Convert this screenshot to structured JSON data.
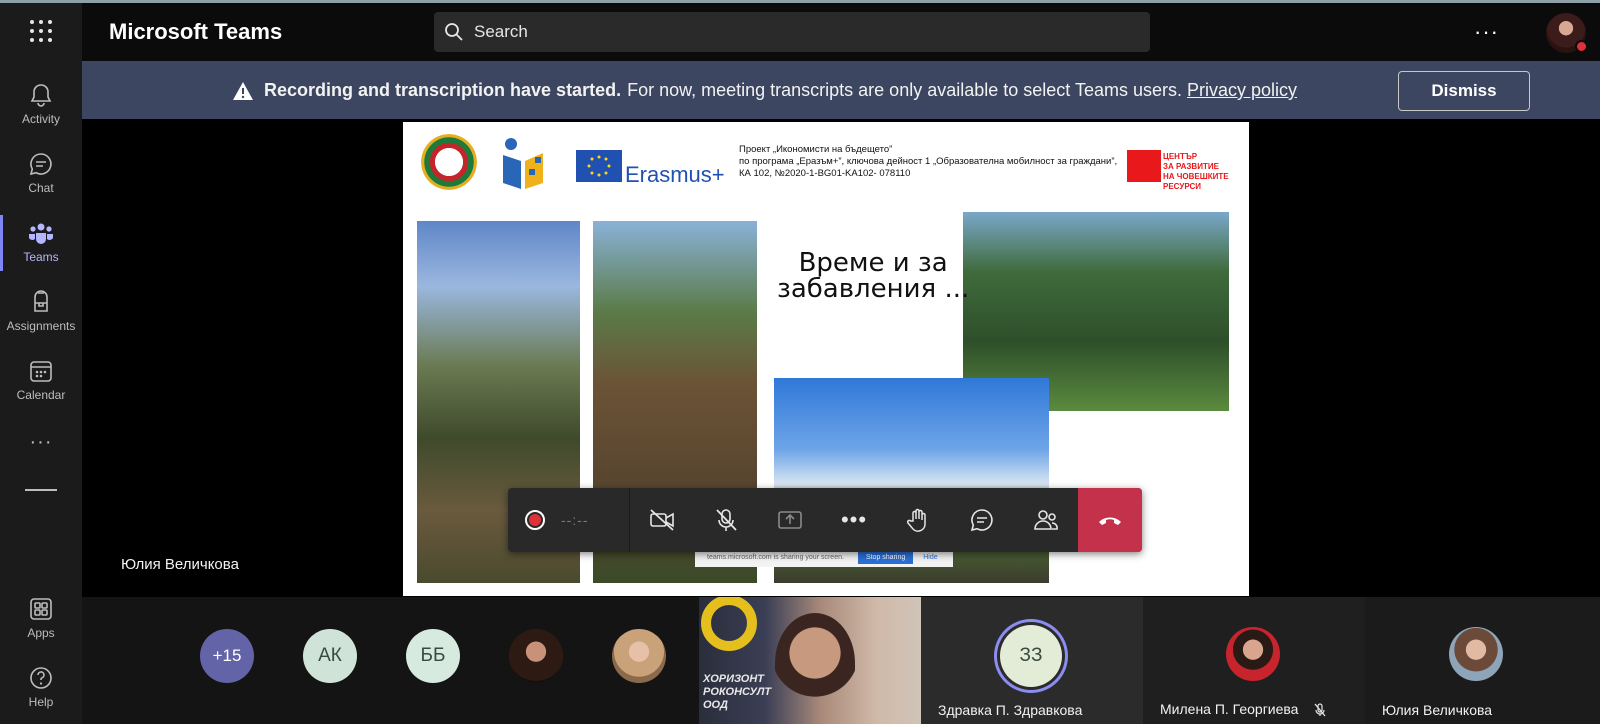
{
  "app": {
    "title": "Microsoft Teams"
  },
  "search": {
    "placeholder": "Search"
  },
  "top": {
    "more": "···"
  },
  "rail": {
    "items": [
      {
        "label": "Activity"
      },
      {
        "label": "Chat"
      },
      {
        "label": "Teams"
      },
      {
        "label": "Assignments"
      },
      {
        "label": "Calendar"
      },
      {
        "label": "Apps"
      },
      {
        "label": "Help"
      }
    ],
    "more": "···"
  },
  "banner": {
    "bold": "Recording and transcription have started.",
    "text": "For now, meeting transcripts are only available to select Teams users.",
    "link": "Privacy policy",
    "dismiss": "Dismiss"
  },
  "slide": {
    "title_line1": "Време и за",
    "title_line2": "забавления ...",
    "eu_text": "Erasmus+",
    "project_line1": "Проект „Икономисти на бъдещето”",
    "project_line2": "по програма „Еразъм+”, ключова дейност 1 „Образователна мобилност за граждани”,",
    "project_line3": "КА 102, №2020-1-BG01-KA102- 078110",
    "hrd_line1": "ЦЕНТЪР",
    "hrd_line2": "ЗА РАЗВИТИЕ",
    "hrd_line3": "НА ЧОВЕШКИТЕ",
    "hrd_line4": "РЕСУРСИ",
    "share_notice": "teams.microsoft.com is sharing your screen.",
    "stop_sharing": "Stop sharing",
    "hide": "Hide"
  },
  "presenter": {
    "name": "Юлия Величкова"
  },
  "controls": {
    "timer": "--:--",
    "more": "•••"
  },
  "participants": {
    "overflow": "+15",
    "ak": "АК",
    "bb": "ББ",
    "tile_brand_line1": "ХОРИЗОНТ",
    "tile_brand_line2": "РОКОНСУЛТ",
    "tile_brand_line3": "ООД",
    "initials_33": "ЗЗ",
    "name_33": "Здравка П. Здравкова",
    "name_ph3": "Милена П. Георгиева",
    "name_ph4": "Юлия Величкова"
  },
  "colors": {
    "accent": "#6264a7",
    "banner": "#3d4661",
    "hangup": "#c4314b",
    "recording": "#e0313b"
  }
}
